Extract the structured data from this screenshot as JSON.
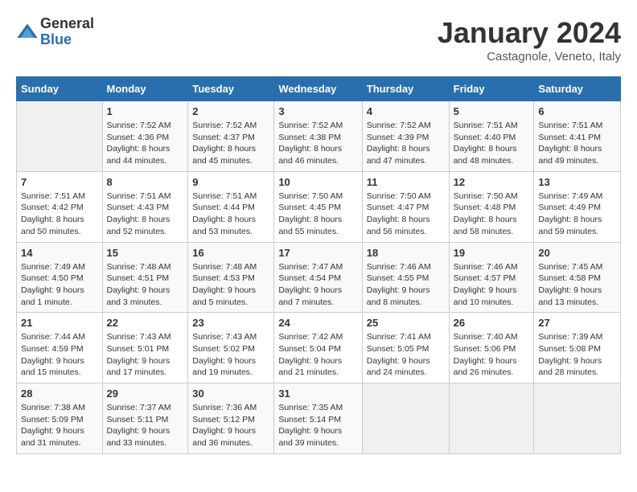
{
  "logo": {
    "general": "General",
    "blue": "Blue"
  },
  "title": "January 2024",
  "location": "Castagnole, Veneto, Italy",
  "days_of_week": [
    "Sunday",
    "Monday",
    "Tuesday",
    "Wednesday",
    "Thursday",
    "Friday",
    "Saturday"
  ],
  "weeks": [
    [
      {
        "day": "",
        "sunrise": "",
        "sunset": "",
        "daylight": ""
      },
      {
        "day": "1",
        "sunrise": "Sunrise: 7:52 AM",
        "sunset": "Sunset: 4:36 PM",
        "daylight": "Daylight: 8 hours and 44 minutes."
      },
      {
        "day": "2",
        "sunrise": "Sunrise: 7:52 AM",
        "sunset": "Sunset: 4:37 PM",
        "daylight": "Daylight: 8 hours and 45 minutes."
      },
      {
        "day": "3",
        "sunrise": "Sunrise: 7:52 AM",
        "sunset": "Sunset: 4:38 PM",
        "daylight": "Daylight: 8 hours and 46 minutes."
      },
      {
        "day": "4",
        "sunrise": "Sunrise: 7:52 AM",
        "sunset": "Sunset: 4:39 PM",
        "daylight": "Daylight: 8 hours and 47 minutes."
      },
      {
        "day": "5",
        "sunrise": "Sunrise: 7:51 AM",
        "sunset": "Sunset: 4:40 PM",
        "daylight": "Daylight: 8 hours and 48 minutes."
      },
      {
        "day": "6",
        "sunrise": "Sunrise: 7:51 AM",
        "sunset": "Sunset: 4:41 PM",
        "daylight": "Daylight: 8 hours and 49 minutes."
      }
    ],
    [
      {
        "day": "7",
        "sunrise": "Sunrise: 7:51 AM",
        "sunset": "Sunset: 4:42 PM",
        "daylight": "Daylight: 8 hours and 50 minutes."
      },
      {
        "day": "8",
        "sunrise": "Sunrise: 7:51 AM",
        "sunset": "Sunset: 4:43 PM",
        "daylight": "Daylight: 8 hours and 52 minutes."
      },
      {
        "day": "9",
        "sunrise": "Sunrise: 7:51 AM",
        "sunset": "Sunset: 4:44 PM",
        "daylight": "Daylight: 8 hours and 53 minutes."
      },
      {
        "day": "10",
        "sunrise": "Sunrise: 7:50 AM",
        "sunset": "Sunset: 4:45 PM",
        "daylight": "Daylight: 8 hours and 55 minutes."
      },
      {
        "day": "11",
        "sunrise": "Sunrise: 7:50 AM",
        "sunset": "Sunset: 4:47 PM",
        "daylight": "Daylight: 8 hours and 56 minutes."
      },
      {
        "day": "12",
        "sunrise": "Sunrise: 7:50 AM",
        "sunset": "Sunset: 4:48 PM",
        "daylight": "Daylight: 8 hours and 58 minutes."
      },
      {
        "day": "13",
        "sunrise": "Sunrise: 7:49 AM",
        "sunset": "Sunset: 4:49 PM",
        "daylight": "Daylight: 8 hours and 59 minutes."
      }
    ],
    [
      {
        "day": "14",
        "sunrise": "Sunrise: 7:49 AM",
        "sunset": "Sunset: 4:50 PM",
        "daylight": "Daylight: 9 hours and 1 minute."
      },
      {
        "day": "15",
        "sunrise": "Sunrise: 7:48 AM",
        "sunset": "Sunset: 4:51 PM",
        "daylight": "Daylight: 9 hours and 3 minutes."
      },
      {
        "day": "16",
        "sunrise": "Sunrise: 7:48 AM",
        "sunset": "Sunset: 4:53 PM",
        "daylight": "Daylight: 9 hours and 5 minutes."
      },
      {
        "day": "17",
        "sunrise": "Sunrise: 7:47 AM",
        "sunset": "Sunset: 4:54 PM",
        "daylight": "Daylight: 9 hours and 7 minutes."
      },
      {
        "day": "18",
        "sunrise": "Sunrise: 7:46 AM",
        "sunset": "Sunset: 4:55 PM",
        "daylight": "Daylight: 9 hours and 8 minutes."
      },
      {
        "day": "19",
        "sunrise": "Sunrise: 7:46 AM",
        "sunset": "Sunset: 4:57 PM",
        "daylight": "Daylight: 9 hours and 10 minutes."
      },
      {
        "day": "20",
        "sunrise": "Sunrise: 7:45 AM",
        "sunset": "Sunset: 4:58 PM",
        "daylight": "Daylight: 9 hours and 13 minutes."
      }
    ],
    [
      {
        "day": "21",
        "sunrise": "Sunrise: 7:44 AM",
        "sunset": "Sunset: 4:59 PM",
        "daylight": "Daylight: 9 hours and 15 minutes."
      },
      {
        "day": "22",
        "sunrise": "Sunrise: 7:43 AM",
        "sunset": "Sunset: 5:01 PM",
        "daylight": "Daylight: 9 hours and 17 minutes."
      },
      {
        "day": "23",
        "sunrise": "Sunrise: 7:43 AM",
        "sunset": "Sunset: 5:02 PM",
        "daylight": "Daylight: 9 hours and 19 minutes."
      },
      {
        "day": "24",
        "sunrise": "Sunrise: 7:42 AM",
        "sunset": "Sunset: 5:04 PM",
        "daylight": "Daylight: 9 hours and 21 minutes."
      },
      {
        "day": "25",
        "sunrise": "Sunrise: 7:41 AM",
        "sunset": "Sunset: 5:05 PM",
        "daylight": "Daylight: 9 hours and 24 minutes."
      },
      {
        "day": "26",
        "sunrise": "Sunrise: 7:40 AM",
        "sunset": "Sunset: 5:06 PM",
        "daylight": "Daylight: 9 hours and 26 minutes."
      },
      {
        "day": "27",
        "sunrise": "Sunrise: 7:39 AM",
        "sunset": "Sunset: 5:08 PM",
        "daylight": "Daylight: 9 hours and 28 minutes."
      }
    ],
    [
      {
        "day": "28",
        "sunrise": "Sunrise: 7:38 AM",
        "sunset": "Sunset: 5:09 PM",
        "daylight": "Daylight: 9 hours and 31 minutes."
      },
      {
        "day": "29",
        "sunrise": "Sunrise: 7:37 AM",
        "sunset": "Sunset: 5:11 PM",
        "daylight": "Daylight: 9 hours and 33 minutes."
      },
      {
        "day": "30",
        "sunrise": "Sunrise: 7:36 AM",
        "sunset": "Sunset: 5:12 PM",
        "daylight": "Daylight: 9 hours and 36 minutes."
      },
      {
        "day": "31",
        "sunrise": "Sunrise: 7:35 AM",
        "sunset": "Sunset: 5:14 PM",
        "daylight": "Daylight: 9 hours and 39 minutes."
      },
      {
        "day": "",
        "sunrise": "",
        "sunset": "",
        "daylight": ""
      },
      {
        "day": "",
        "sunrise": "",
        "sunset": "",
        "daylight": ""
      },
      {
        "day": "",
        "sunrise": "",
        "sunset": "",
        "daylight": ""
      }
    ]
  ]
}
